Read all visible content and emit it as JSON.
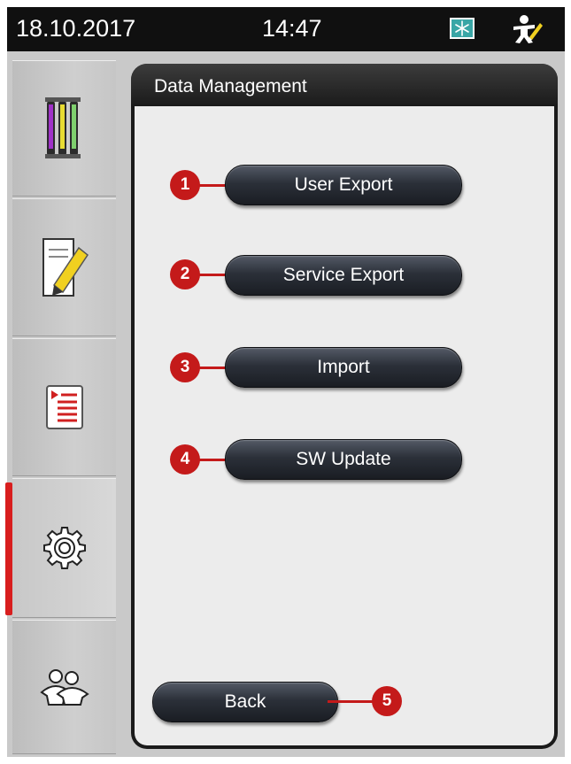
{
  "status": {
    "date": "18.10.2017",
    "time": "14:47",
    "left_icon": "snowflake-icon",
    "right_icon": "user-edit-icon"
  },
  "sidebar": {
    "tabs": [
      {
        "icon": "reagent-tubes-icon",
        "active": false
      },
      {
        "icon": "note-pencil-icon",
        "active": false
      },
      {
        "icon": "program-list-icon",
        "active": false
      },
      {
        "icon": "gear-icon",
        "active": true
      },
      {
        "icon": "users-icon",
        "active": false
      }
    ],
    "active_color": "#d81e1e"
  },
  "panel": {
    "title": "Data Management"
  },
  "buttons": {
    "user_export": "User Export",
    "service_export": "Service Export",
    "import": "Import",
    "sw_update": "SW Update",
    "back": "Back"
  },
  "callouts": [
    "1",
    "2",
    "3",
    "4",
    "5"
  ],
  "colors": {
    "callout": "#c41a1a",
    "status_icon_bg": "#39a6a6"
  }
}
